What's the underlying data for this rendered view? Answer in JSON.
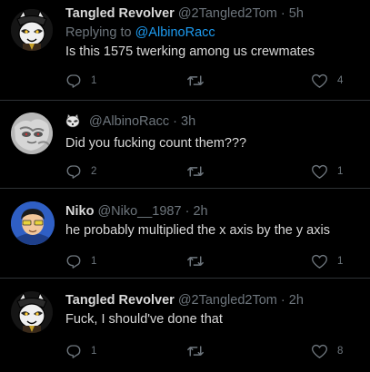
{
  "tweets": [
    {
      "author_name": "Tangled Revolver",
      "handle": "@2Tangled2Tom",
      "sep": "·",
      "time": "5h",
      "reply_prefix": "Replying to",
      "reply_mention": "@AlbinoRacc",
      "text": "Is this 1575 twerking among us crewmates",
      "reply_count": "1",
      "retweet_count": "",
      "like_count": "4"
    },
    {
      "author_name": "",
      "handle": "@AlbinoRacc",
      "sep": "·",
      "time": "3h",
      "text": "Did you fucking count them???",
      "reply_count": "2",
      "retweet_count": "",
      "like_count": "1"
    },
    {
      "author_name": "Niko",
      "handle": "@Niko__1987",
      "sep": "·",
      "time": "2h",
      "text": "he probably multiplied the x axis by the y axis",
      "reply_count": "1",
      "retweet_count": "",
      "like_count": "1"
    },
    {
      "author_name": "Tangled Revolver",
      "handle": "@2Tangled2Tom",
      "sep": "·",
      "time": "2h",
      "text": "Fuck, I should've done that",
      "reply_count": "1",
      "retweet_count": "",
      "like_count": "8"
    }
  ],
  "icons": {
    "reply": "reply-icon",
    "retweet": "retweet-icon",
    "like": "heart-icon",
    "badge": "raccoon-emoji-icon"
  },
  "colors": {
    "background": "#000000",
    "text": "#d9d9d9",
    "muted": "#6e767d",
    "link": "#1d9bf0",
    "divider": "#2f3336"
  }
}
